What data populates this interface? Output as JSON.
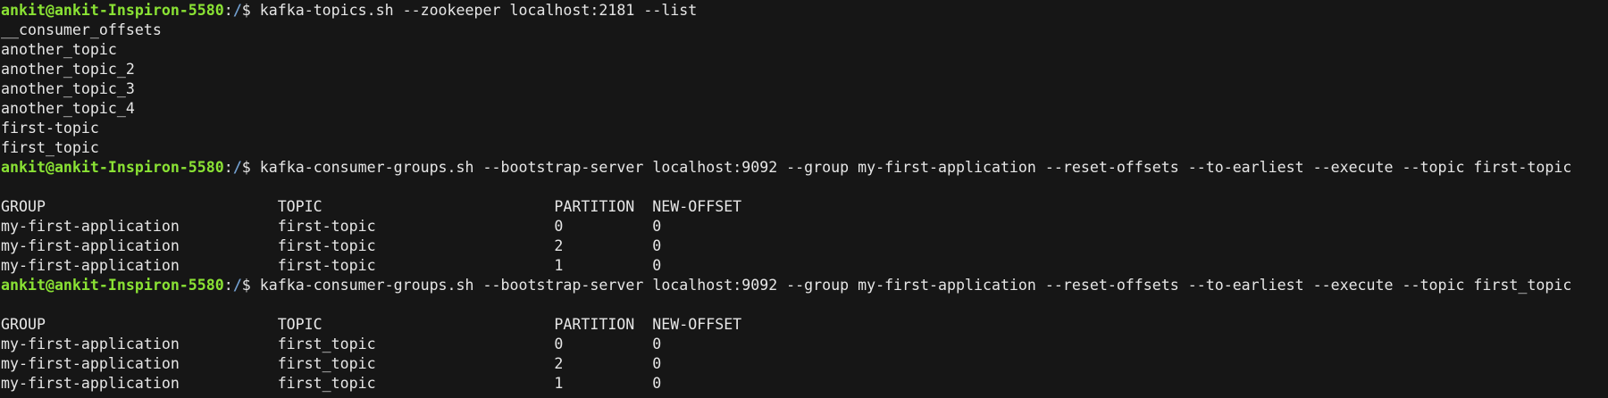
{
  "terminal": {
    "colors": {
      "background": "#161616",
      "foreground": "#e6e6e6",
      "prompt_user_host": "#8ae234",
      "prompt_path": "#729fcf"
    },
    "prompt": {
      "user_host": "ankit@ankit-Inspiron-5580",
      "separator": ":",
      "path": "/",
      "symbol": "$"
    },
    "blocks": [
      {
        "command": "kafka-topics.sh --zookeeper localhost:2181 --list",
        "output": [
          "__consumer_offsets",
          "another_topic",
          "another_topic_2",
          "another_topic_3",
          "another_topic_4",
          "first-topic",
          "first_topic"
        ]
      },
      {
        "command": "kafka-consumer-groups.sh --bootstrap-server localhost:9092 --group my-first-application --reset-offsets --to-earliest --execute --topic first-topic",
        "table": {
          "headers": [
            "GROUP",
            "TOPIC",
            "PARTITION",
            "NEW-OFFSET"
          ],
          "rows": [
            [
              "my-first-application",
              "first-topic",
              "0",
              "0"
            ],
            [
              "my-first-application",
              "first-topic",
              "2",
              "0"
            ],
            [
              "my-first-application",
              "first-topic",
              "1",
              "0"
            ]
          ]
        }
      },
      {
        "command": "kafka-consumer-groups.sh --bootstrap-server localhost:9092 --group my-first-application --reset-offsets --to-earliest --execute --topic first_topic",
        "table": {
          "headers": [
            "GROUP",
            "TOPIC",
            "PARTITION",
            "NEW-OFFSET"
          ],
          "rows": [
            [
              "my-first-application",
              "first_topic",
              "0",
              "0"
            ],
            [
              "my-first-application",
              "first_topic",
              "2",
              "0"
            ],
            [
              "my-first-application",
              "first_topic",
              "1",
              "0"
            ]
          ]
        }
      }
    ]
  }
}
